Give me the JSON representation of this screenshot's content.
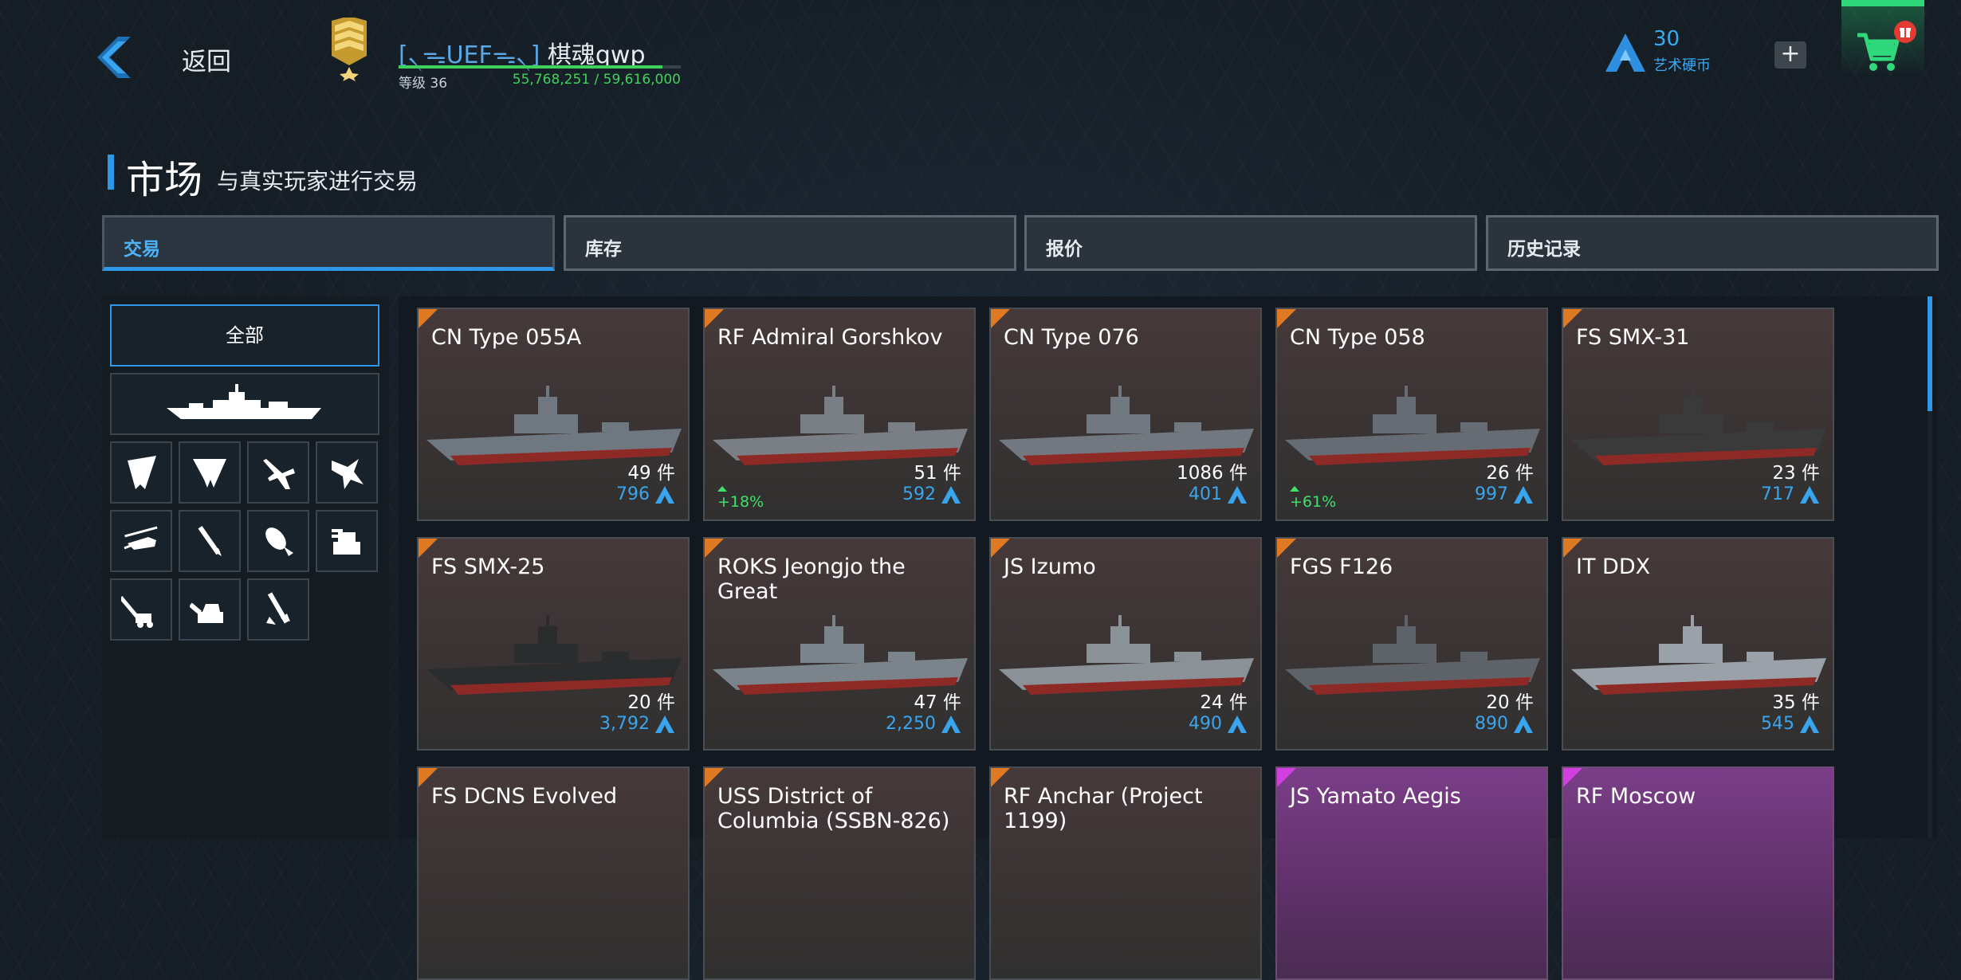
{
  "header": {
    "back_label": "返回",
    "player": {
      "clan": "[৲ᯓUEFᯓ৲]",
      "name": "棋魂qwp",
      "level": "等级 36",
      "xp": "55,768,251 / 59,616,000",
      "xp_fraction": 0.935
    },
    "coins": {
      "count": "30",
      "label": "艺术硬币"
    },
    "plus": "+",
    "cart_badge": "🎁"
  },
  "page": {
    "title": "市场",
    "subtitle": "与真实玩家进行交易"
  },
  "tabs": [
    {
      "label": "交易",
      "active": true
    },
    {
      "label": "库存",
      "active": false
    },
    {
      "label": "报价",
      "active": false
    },
    {
      "label": "历史记录",
      "active": false
    }
  ],
  "filters": {
    "all_label": "全部",
    "icons": [
      "flying-wing-bomber-icon",
      "stealth-bomber-icon",
      "fighter-jet-icon",
      "stealth-fighter-icon",
      "helicopter-icon",
      "missile-icon",
      "bomb-icon",
      "turret-icon",
      "artillery-icon",
      "gun-turret-icon",
      "rocket-icon"
    ]
  },
  "items": [
    {
      "name": "CN Type 055A",
      "count": "49 件",
      "price": "796",
      "change": "",
      "rarity": "legendary"
    },
    {
      "name": "RF Admiral Gorshkov",
      "count": "51 件",
      "price": "592",
      "change": "+18%",
      "rarity": "legendary"
    },
    {
      "name": "CN Type 076",
      "count": "1086 件",
      "price": "401",
      "change": "",
      "rarity": "legendary"
    },
    {
      "name": "CN Type 058",
      "count": "26 件",
      "price": "997",
      "change": "+61%",
      "rarity": "legendary"
    },
    {
      "name": "FS SMX-31",
      "count": "23 件",
      "price": "717",
      "change": "",
      "rarity": "legendary"
    },
    {
      "name": "FS SMX-25",
      "count": "20 件",
      "price": "3,792",
      "change": "",
      "rarity": "legendary"
    },
    {
      "name": "ROKS Jeongjo the Great",
      "count": "47 件",
      "price": "2,250",
      "change": "",
      "rarity": "legendary"
    },
    {
      "name": "JS Izumo",
      "count": "24 件",
      "price": "490",
      "change": "",
      "rarity": "legendary"
    },
    {
      "name": "FGS F126",
      "count": "20 件",
      "price": "890",
      "change": "",
      "rarity": "legendary"
    },
    {
      "name": "IT DDX",
      "count": "35 件",
      "price": "545",
      "change": "",
      "rarity": "legendary"
    },
    {
      "name": "FS DCNS Evolved",
      "count": "",
      "price": "",
      "change": "",
      "rarity": "legendary"
    },
    {
      "name": "USS District of Columbia (SSBN-826)",
      "count": "",
      "price": "",
      "change": "",
      "rarity": "legendary"
    },
    {
      "name": "RF Anchar (Project 1199)",
      "count": "",
      "price": "",
      "change": "",
      "rarity": "legendary"
    },
    {
      "name": "JS Yamato Aegis",
      "count": "",
      "price": "",
      "change": "",
      "rarity": "epic"
    },
    {
      "name": "RF Moscow",
      "count": "",
      "price": "",
      "change": "",
      "rarity": "epic"
    }
  ],
  "colors": {
    "accent": "#2e97e8",
    "positive": "#40e06a",
    "coin": "#3aa5ef",
    "legendary_corner": "#e07a22",
    "epic_corner": "#d13fe0"
  }
}
